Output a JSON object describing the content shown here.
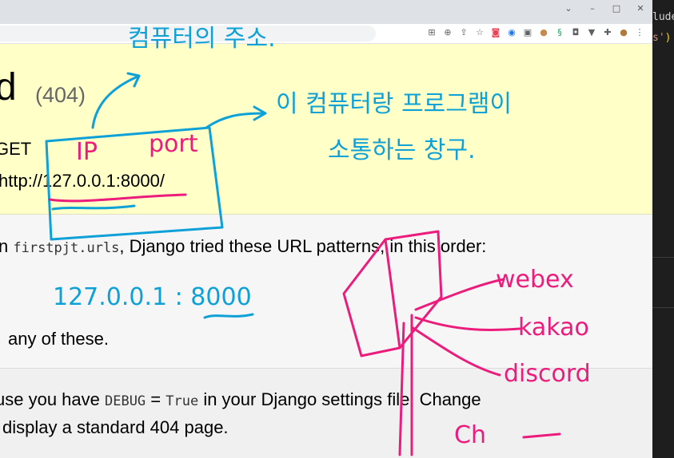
{
  "window": {
    "controls": [
      "⌄",
      "–",
      "□",
      "✕"
    ]
  },
  "toolbar": {
    "extensions": [
      "translate-icon",
      "zoom-icon",
      "share-icon",
      "bookmark-star-icon",
      "pocket-icon",
      "circle-ext-icon",
      "app-ext-icon",
      "avatar-ext-icon",
      "s-ext-icon",
      "camera-ext-icon",
      "v-ext-icon",
      "puzzle-icon",
      "profile-icon",
      "menu-icon"
    ]
  },
  "editor": {
    "line1": "lude",
    "line2_text": "s'",
    "line2_paren": ")"
  },
  "summary": {
    "title_fragment": "d",
    "status": "(404)",
    "method_fragment": "GET",
    "url_fragment": "http://127.0.0.1:8000/"
  },
  "info": {
    "prefix": "n ",
    "module": "firstpjt.urls",
    "suffix": ", Django tried these URL patterns, in this order:",
    "line2": "any of these."
  },
  "explain": {
    "line1_a": "use you have ",
    "debug": "DEBUG",
    "eq": " = ",
    "true": "True",
    "line1_b": " in your Django settings file. Change",
    "line2": "l display a standard 404 page."
  },
  "annotations": {
    "korean_top": "컴퓨터의 주소.",
    "ip": "IP",
    "port": "port",
    "korean_right_1": "이 컴퓨터랑  프로그램이",
    "korean_right_2": "소통하는 창구.",
    "ip_port_number": "127.0.0.1 : 8000",
    "webex": "webex",
    "kakao": "kakao",
    "discord": "discord",
    "ch": "Ch"
  },
  "colors": {
    "annotation_blue": "#0ea1d8",
    "annotation_pink": "#ec1c7c",
    "summary_bg": "#ffffc8"
  }
}
